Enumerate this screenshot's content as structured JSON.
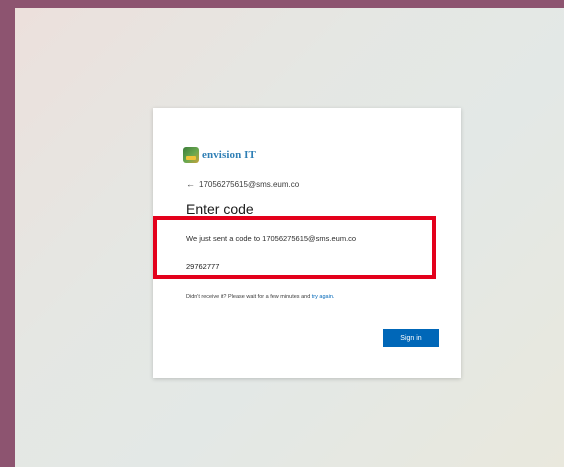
{
  "brand": {
    "logo_text": "envision IT"
  },
  "account": {
    "back_arrow": "←",
    "email": "17056275615@sms.eum.co"
  },
  "form": {
    "title": "Enter code",
    "sent_message": "We just sent a code to 17056275615@sms.eum.co",
    "code_value": "29762777",
    "resend_prefix": "Didn't receive it? Please wait for a few minutes and ",
    "resend_link": "try again.",
    "submit_label": "Sign in"
  },
  "colors": {
    "accent": "#0067b8",
    "highlight": "#e3001b",
    "frame": "#8d5470"
  }
}
